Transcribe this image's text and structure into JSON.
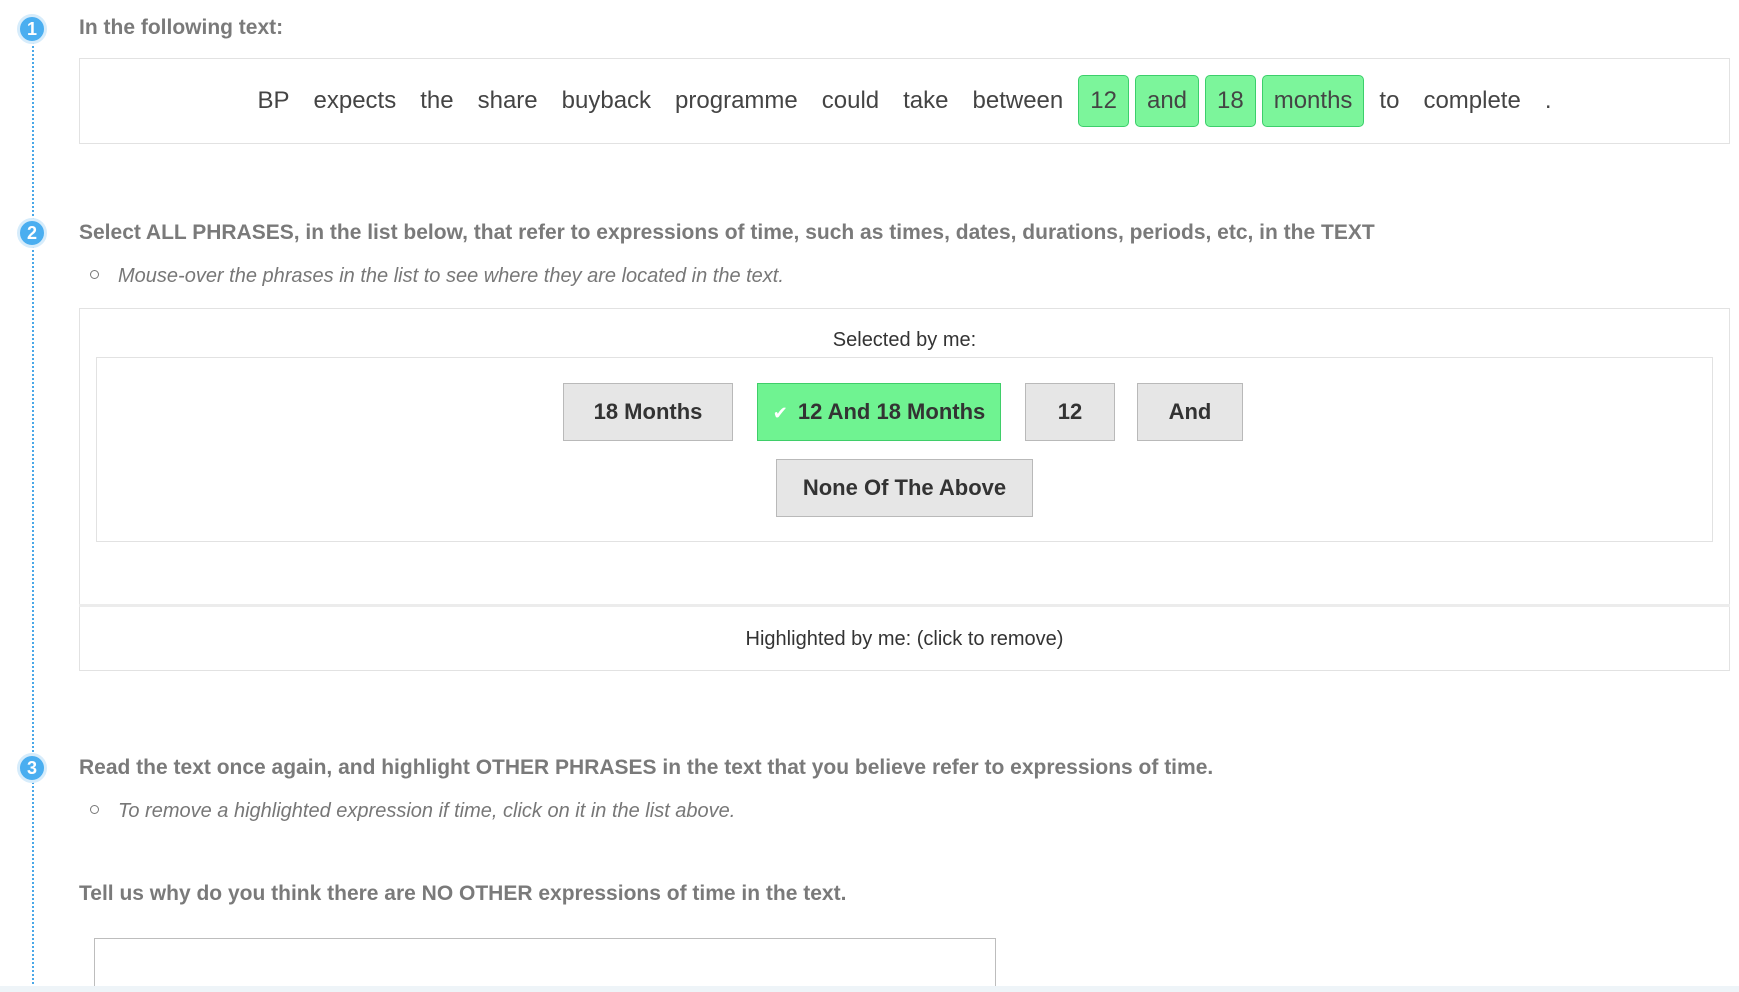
{
  "steps": [
    {
      "number": "1",
      "heading": "In the following text:"
    },
    {
      "number": "2",
      "heading": "Select ALL PHRASES, in the list below, that refer to expressions of time, such as times, dates, durations, periods, etc, in the TEXT",
      "note": "Mouse-over the phrases in the list to see where they are located in the text."
    },
    {
      "number": "3",
      "heading": "Read the text once again, and highlight OTHER PHRASES in the text that you believe refer to expressions of time.",
      "note": "To remove a highlighted expression if time, click on it in the list above."
    }
  ],
  "text_words": [
    {
      "text": "BP",
      "highlighted": false
    },
    {
      "text": "expects",
      "highlighted": false
    },
    {
      "text": "the",
      "highlighted": false
    },
    {
      "text": "share",
      "highlighted": false
    },
    {
      "text": "buyback",
      "highlighted": false
    },
    {
      "text": "programme",
      "highlighted": false
    },
    {
      "text": "could",
      "highlighted": false
    },
    {
      "text": "take",
      "highlighted": false
    },
    {
      "text": "between",
      "highlighted": false
    },
    {
      "text": "12",
      "highlighted": true
    },
    {
      "text": "and",
      "highlighted": true
    },
    {
      "text": "18",
      "highlighted": true
    },
    {
      "text": "months",
      "highlighted": true
    },
    {
      "text": "to",
      "highlighted": false
    },
    {
      "text": "complete",
      "highlighted": false
    },
    {
      "text": ".",
      "highlighted": false
    }
  ],
  "selection_panel": {
    "selected_label": "Selected by me:",
    "highlighted_label": "Highlighted by me: (click to remove)",
    "options": [
      {
        "label": "18 Months",
        "selected": false
      },
      {
        "label": "12 And 18 Months",
        "selected": true
      },
      {
        "label": "12",
        "selected": false
      },
      {
        "label": "And",
        "selected": false
      },
      {
        "label": "None Of The Above",
        "selected": false
      }
    ]
  },
  "reason": {
    "question": "Tell us why do you think there are NO OTHER expressions of time in the text.",
    "value": ""
  },
  "colors": {
    "highlight": "#7cf59b",
    "selected_option": "#6ff391",
    "step_badge": "#4aaef0"
  }
}
